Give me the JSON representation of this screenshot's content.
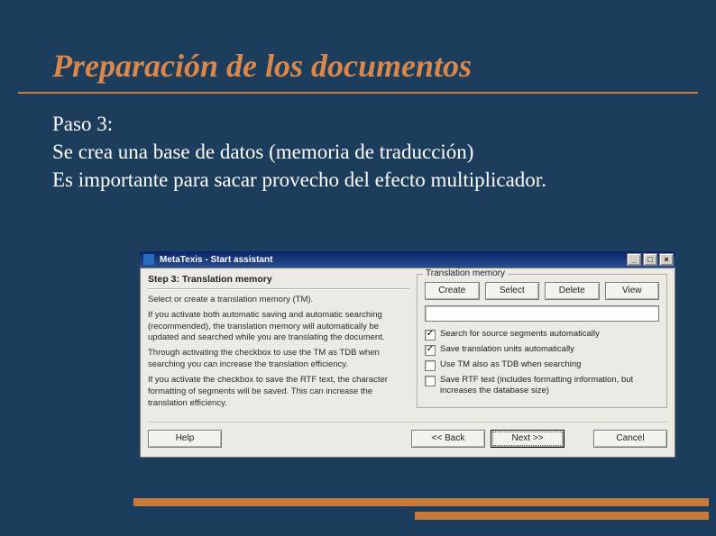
{
  "slide": {
    "title": "Preparación de los documentos",
    "paso_label": "Paso 3:",
    "paso_line1": "Se crea una base de datos (memoria de traducción)",
    "paso_line2": "Es importante para sacar provecho del efecto multiplicador."
  },
  "dialog": {
    "window_title": "MetaTexis - Start assistant",
    "btn_min": "_",
    "btn_max": "□",
    "btn_close": "×",
    "step_title": "Step 3: Translation memory",
    "intro": "Select or create a translation memory (TM).",
    "para1": "If you activate both automatic saving and automatic searching (recommended), the translation memory will automatically be updated and searched while you are translating the document.",
    "para2": "Through activating the checkbox to use the TM as TDB when searching you can increase the translation efficiency.",
    "para3": "If you activate the checkbox to save the RTF text, the character formatting of segments will be saved. This can increase the translation efficiency.",
    "group_label": "Translation memory",
    "btn_create": "Create",
    "btn_select": "Select",
    "btn_delete": "Delete",
    "btn_view": "View",
    "tm_path": "",
    "chk1": "Search for source segments automatically",
    "chk2": "Save translation units automatically",
    "chk3": "Use TM also as TDB when searching",
    "chk4": "Save RTF text (includes formatting information, but increases the database size)",
    "btn_help": "Help",
    "btn_back": "<< Back",
    "btn_next": "Next >>",
    "btn_cancel": "Cancel"
  }
}
